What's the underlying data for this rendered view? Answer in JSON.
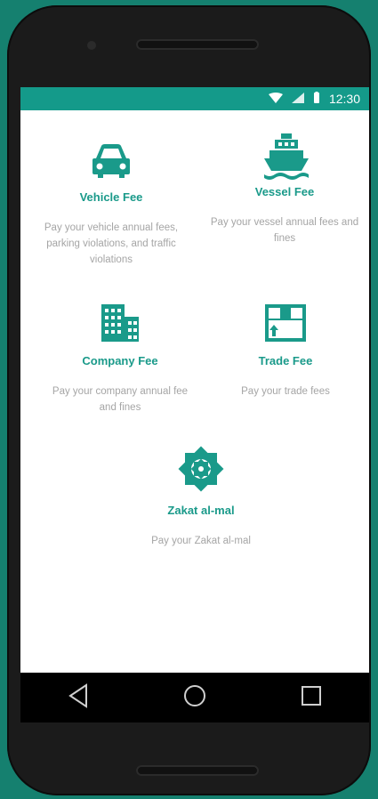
{
  "status_bar": {
    "time": "12:30",
    "wifi_icon": "wifi-icon",
    "signal_icon": "cell-signal-icon",
    "battery_icon": "battery-icon"
  },
  "tiles": [
    {
      "id": "vehicle",
      "title": "Vehicle Fee",
      "description": "Pay your vehicle annual fees, parking violations, and traffic violations",
      "icon": "car-icon"
    },
    {
      "id": "vessel",
      "title": "Vessel Fee",
      "description": "Pay your vessel annual fees and fines",
      "icon": "ship-icon"
    },
    {
      "id": "company",
      "title": "Company Fee",
      "description": "Pay your company annual fee and fines",
      "icon": "building-icon"
    },
    {
      "id": "trade",
      "title": "Trade Fee",
      "description": "Pay your trade fees",
      "icon": "box-icon"
    },
    {
      "id": "zakat",
      "title": "Zakat al-mal",
      "description": "Pay your Zakat al-mal",
      "icon": "star-emblem-icon"
    }
  ],
  "nav": {
    "back_icon": "back-triangle-icon",
    "home_icon": "home-circle-icon",
    "recents_icon": "recents-square-icon"
  },
  "colors": {
    "accent": "#1a9a8a",
    "status_bar": "#149a8a",
    "muted_text": "#a5a5a5",
    "background": "#15806f"
  }
}
